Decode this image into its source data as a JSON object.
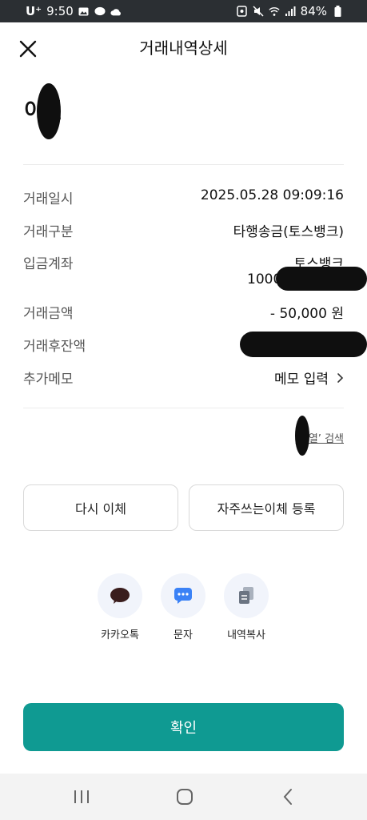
{
  "status_bar": {
    "carrier": "U⁺",
    "time": "9:50",
    "battery": "84%",
    "icons": [
      "gallery-icon",
      "talk-icon",
      "cloud-icon",
      "alarm-icon",
      "mute-icon",
      "wifi-icon",
      "signal-icon",
      "battery-icon"
    ]
  },
  "header": {
    "title": "거래내역상세",
    "close_icon": "close-icon"
  },
  "recipient": {
    "name": "이열"
  },
  "details": [
    {
      "label": "거래일시",
      "value": "2025.05.28 09:09:16"
    },
    {
      "label": "거래구분",
      "value": "타행송금(토스뱅크)"
    },
    {
      "label": "입금계좌",
      "value": "토스뱅크",
      "value2": "1000"
    },
    {
      "label": "거래금액",
      "value": "- 50,000 원"
    },
    {
      "label": "거래후잔액",
      "value": ""
    },
    {
      "label": "추가메모",
      "value": "메모 입력"
    }
  ],
  "search_link": "‘이열’ 검색",
  "actions": {
    "retransfer": "다시 이체",
    "register_favorite": "자주쓰는이체 등록"
  },
  "share": [
    {
      "label": "카카오톡",
      "icon": "kakaotalk-icon"
    },
    {
      "label": "문자",
      "icon": "message-icon"
    },
    {
      "label": "내역복사",
      "icon": "copy-icon"
    }
  ],
  "confirm": "확인",
  "colors": {
    "accent": "#0f9a92",
    "status_bar": "#2b2f33",
    "nav_bar": "#f3f3f3"
  }
}
